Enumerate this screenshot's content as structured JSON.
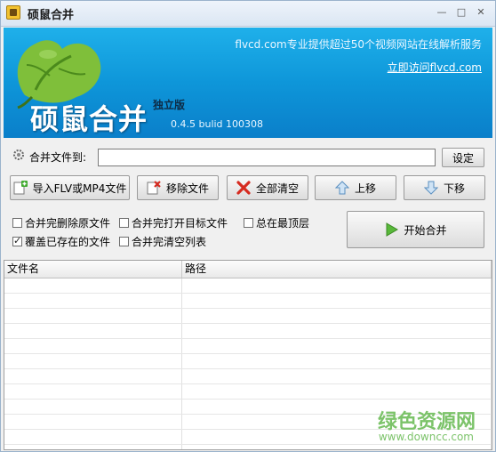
{
  "window": {
    "title": "硕鼠合并"
  },
  "banner": {
    "brand": "硕鼠合并",
    "edition": "独立版",
    "version": "0.4.5 bulid 100308",
    "slogan": "flvcd.com专业提供超过50个视频网站在线解析服务",
    "link": "立即访问flvcd.com"
  },
  "merge": {
    "label": "合并文件到:",
    "value": "",
    "set_button": "设定"
  },
  "toolbar": {
    "import": "导入FLV或MP4文件",
    "remove": "移除文件",
    "clear": "全部清空",
    "up": "上移",
    "down": "下移"
  },
  "options": [
    {
      "label": "合并完删除原文件",
      "checked": false
    },
    {
      "label": "合并完打开目标文件",
      "checked": false
    },
    {
      "label": "总在最顶层",
      "checked": false
    },
    {
      "label": "覆盖已存在的文件",
      "checked": true
    },
    {
      "label": "合并完清空列表",
      "checked": false
    }
  ],
  "start_button": "开始合并",
  "table": {
    "columns": [
      "文件名",
      "路径"
    ],
    "rows": []
  },
  "watermark": {
    "text": "绿色资源网",
    "url": "www.downcc.com"
  }
}
